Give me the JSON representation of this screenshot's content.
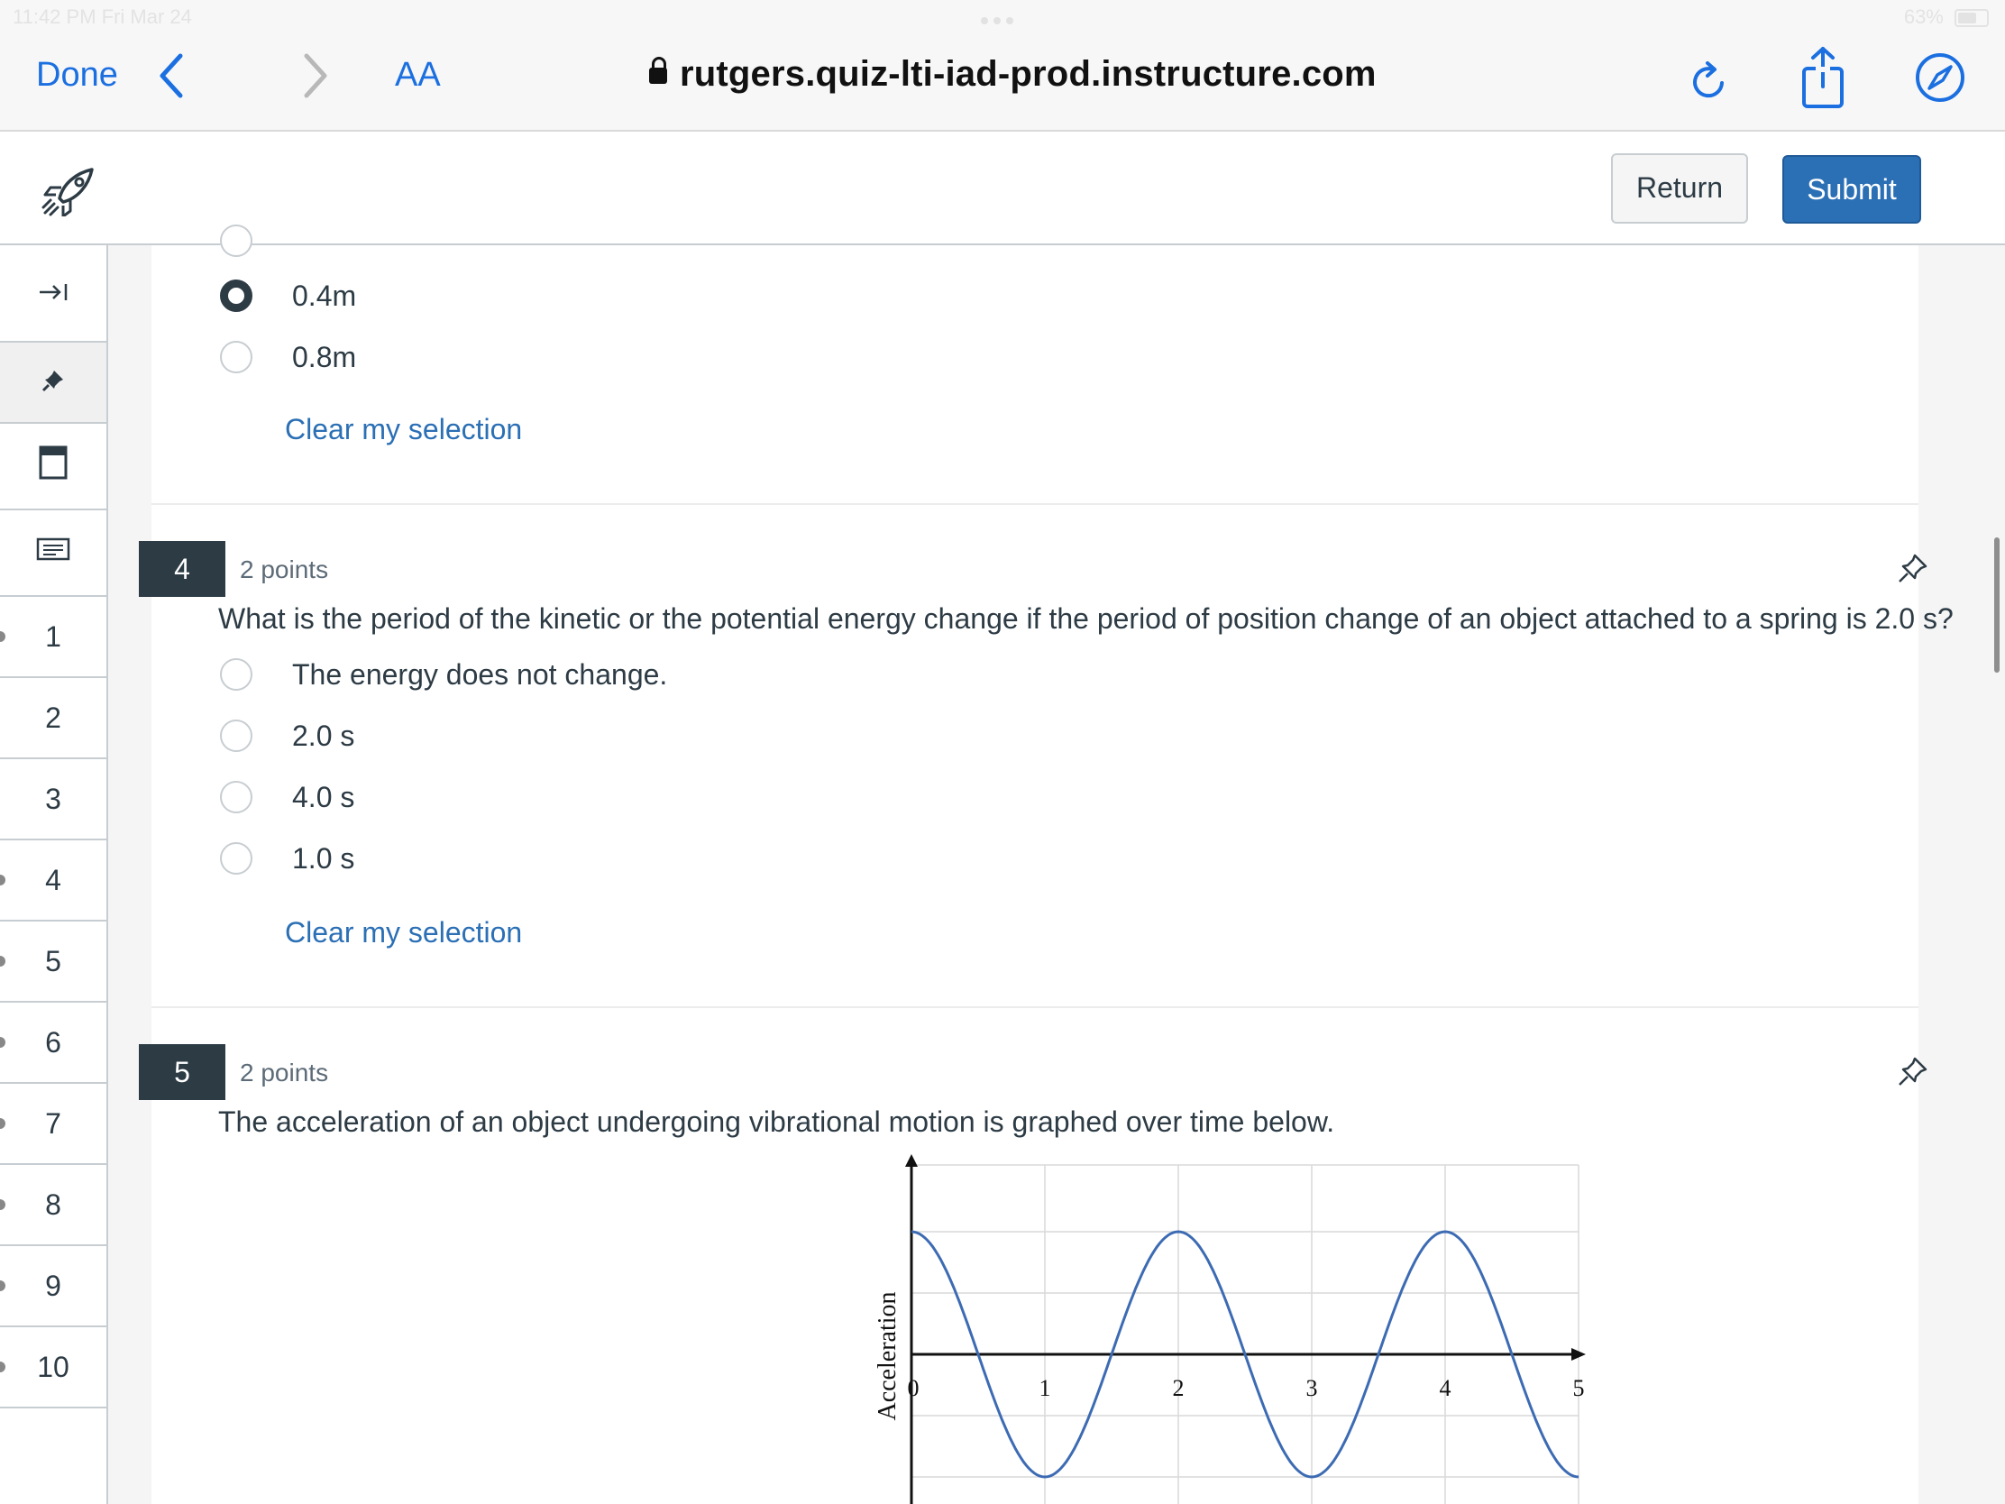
{
  "status_bar": {
    "time": "11:42 PM   Fri Mar 24",
    "battery": "63%"
  },
  "browser": {
    "done_label": "Done",
    "text_size_label": "AA",
    "url": "rutgers.quiz-lti-iad-prod.instructure.com"
  },
  "header": {
    "return_label": "Return",
    "submit_label": "Submit"
  },
  "sidebar": {
    "questions": [
      "1",
      "2",
      "3",
      "4",
      "5",
      "6",
      "7",
      "8",
      "9",
      "10"
    ]
  },
  "question3": {
    "options": [
      {
        "label": "0.4m",
        "selected": true
      },
      {
        "label": "0.8m",
        "selected": false
      }
    ],
    "clear_label": "Clear my selection"
  },
  "question4": {
    "number": "4",
    "points": "2 points",
    "text": "What is the period of the kinetic or the potential energy change if the period of position change of an object attached to a spring is 2.0 s?",
    "options": [
      {
        "label": "The energy does not change.",
        "selected": false
      },
      {
        "label": "2.0 s",
        "selected": false
      },
      {
        "label": "4.0 s",
        "selected": false
      },
      {
        "label": "1.0 s",
        "selected": false
      }
    ],
    "clear_label": "Clear my selection"
  },
  "question5": {
    "number": "5",
    "points": "2 points",
    "text": "The acceleration of an object undergoing vibrational motion is graphed over time below."
  },
  "chart_data": {
    "type": "line",
    "title": "",
    "xlabel": "",
    "ylabel": "Acceleration",
    "x_ticks": [
      "0",
      "1",
      "2",
      "3",
      "4",
      "5"
    ],
    "xlim": [
      0,
      5
    ],
    "ylim": [
      -1.2,
      1.2
    ],
    "grid": true,
    "series": [
      {
        "function": "cos(pi * t)",
        "x": [
          0,
          0.5,
          1,
          1.5,
          2,
          2.5,
          3,
          3.5,
          4,
          4.5,
          5
        ],
        "values": [
          1,
          0,
          -1,
          0,
          1,
          0,
          -1,
          0,
          1,
          0,
          -1
        ]
      }
    ],
    "line_color": "#3d6bb3"
  }
}
